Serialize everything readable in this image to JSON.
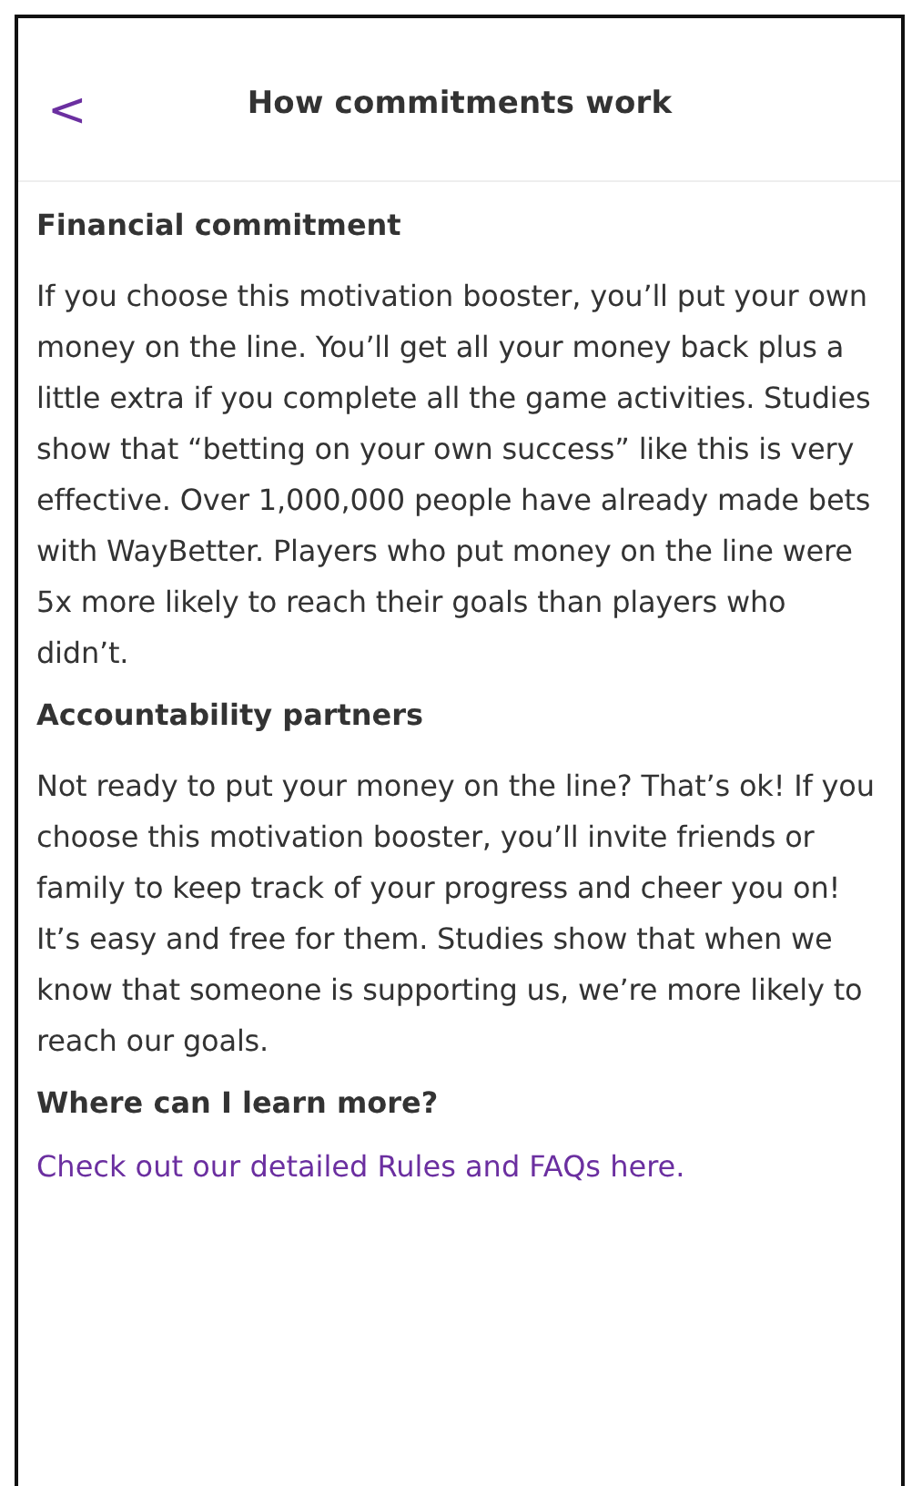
{
  "header": {
    "back_icon": "<",
    "title": "How commitments work"
  },
  "sections": [
    {
      "heading": "Financial commitment",
      "body": "If you choose this motivation booster, you’ll put your own money on the line. You’ll get all your money back plus a little extra if you complete all the game activities. Studies show that “betting on your own success” like this is very effective. Over 1,000,000 people have already made bets with WayBetter. Players who put money on the line were 5x more likely to reach their goals than players who didn’t."
    },
    {
      "heading": "Accountability partners",
      "body": "Not ready to put your money on the line? That’s ok! If you choose this motivation booster, you’ll invite friends or family to keep track of your progress and cheer you on! It’s easy and free for them. Studies show that when we know that someone is supporting us, we’re more likely to reach our goals."
    },
    {
      "heading": "Where can I learn more?",
      "link": "Check out our detailed Rules and FAQs here."
    }
  ]
}
